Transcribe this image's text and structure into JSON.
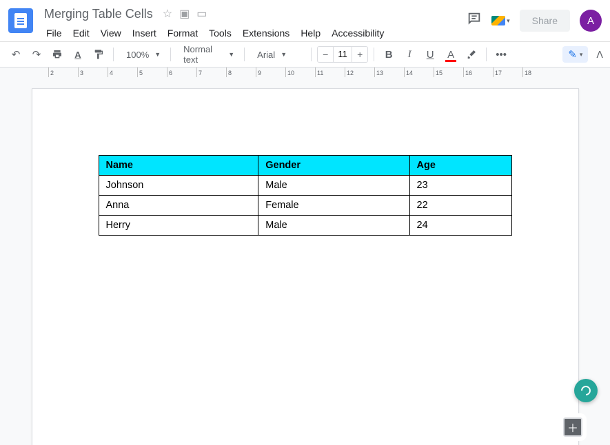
{
  "doc": {
    "title": "Merging Table Cells"
  },
  "menus": [
    "File",
    "Edit",
    "View",
    "Insert",
    "Format",
    "Tools",
    "Extensions",
    "Help",
    "Accessibility"
  ],
  "header": {
    "share_label": "Share",
    "avatar_initial": "A"
  },
  "toolbar": {
    "zoom": "100%",
    "style": "Normal text",
    "font": "Arial",
    "font_size": "11"
  },
  "table": {
    "headers": [
      "Name",
      "Gender",
      "Age"
    ],
    "rows": [
      {
        "c0": "Johnson",
        "c1": "Male",
        "c2": "23"
      },
      {
        "c0": "Anna",
        "c1": "Female",
        "c2": "22"
      },
      {
        "c0": "Herry",
        "c1": "Male",
        "c2": "24"
      }
    ]
  },
  "ruler": {
    "start": 2,
    "end": 18
  }
}
